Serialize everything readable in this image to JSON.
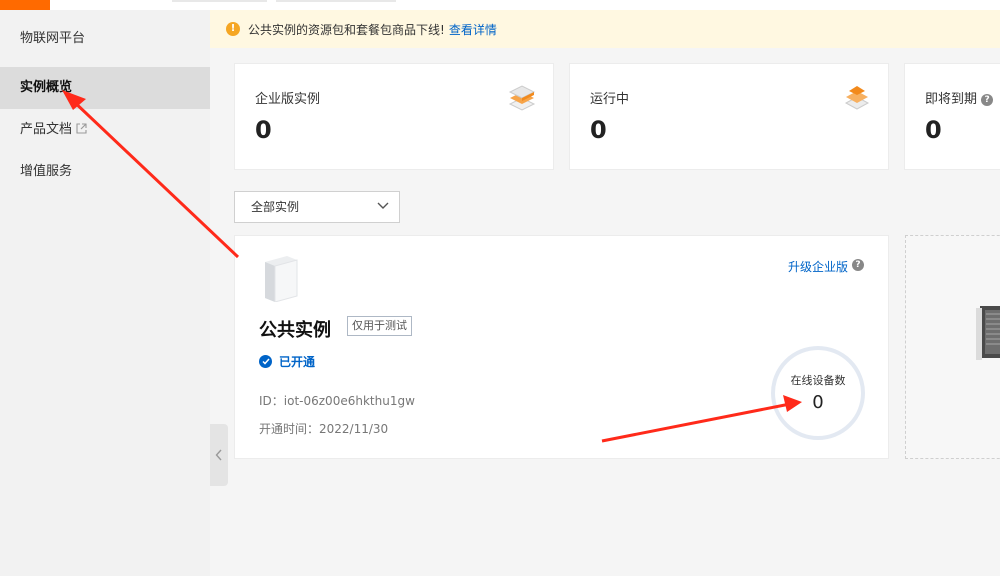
{
  "sidebar": {
    "items": [
      {
        "label": "物联网平台"
      },
      {
        "label": "实例概览"
      },
      {
        "label": "产品文档"
      },
      {
        "label": "增值服务"
      }
    ]
  },
  "notice": {
    "text": "公共实例的资源包和套餐包商品下线!",
    "link": "查看详情"
  },
  "stats": [
    {
      "label": "企业版实例",
      "value": "0"
    },
    {
      "label": "运行中",
      "value": "0"
    },
    {
      "label": "即将到期",
      "value": "0"
    }
  ],
  "filter": {
    "selected": "全部实例"
  },
  "instance": {
    "name": "公共实例",
    "tag": "仅用于测试",
    "status": "已开通",
    "id": "ID：iot-06z00e6hkthu1gw",
    "opened": "开通时间：2022/11/30",
    "upgrade": "升级企业版",
    "online_label": "在线设备数",
    "online_value": "0"
  },
  "colors": {
    "accent": "#ff6a00",
    "link": "#0064c8",
    "annotation": "#ff2a1a"
  }
}
